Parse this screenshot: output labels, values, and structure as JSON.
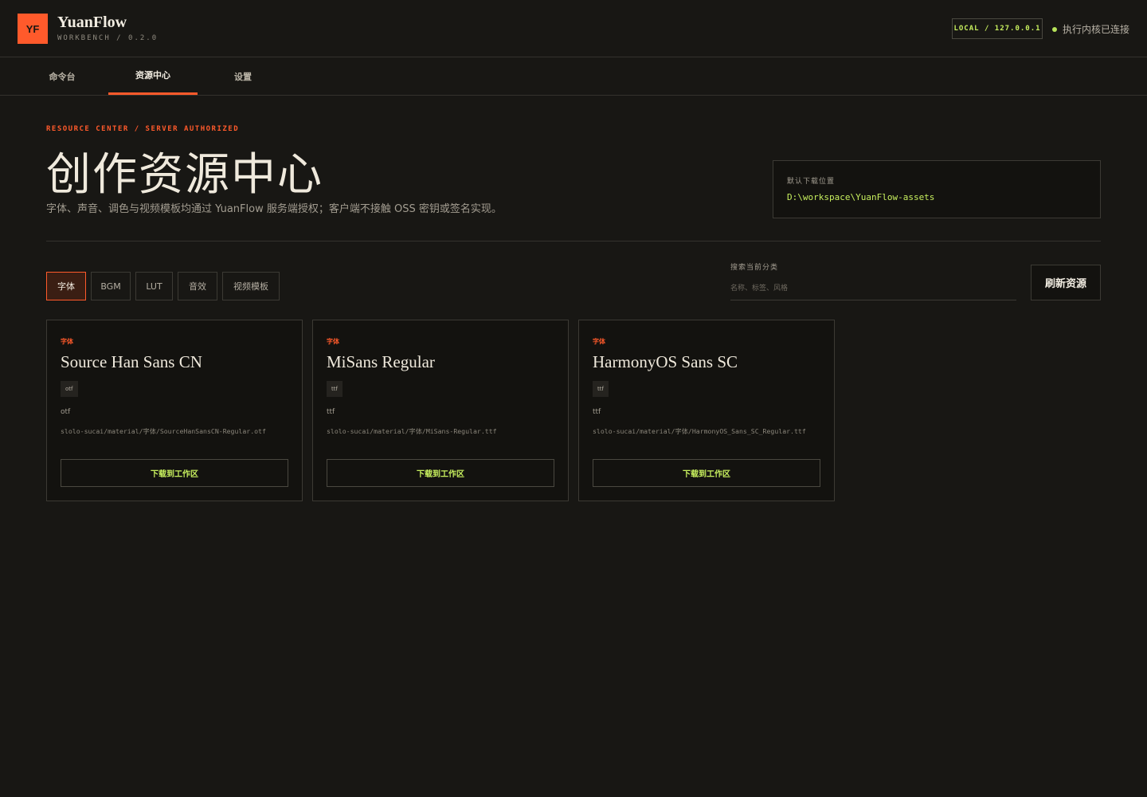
{
  "app": {
    "logo_text": "YF",
    "name": "YuanFlow",
    "version": "WORKBENCH / 0.2.0",
    "server_badge": "LOCAL / 127.0.0.1",
    "status_text": "执行内核已连接",
    "accent_color": "#ff5a2b",
    "ok_color": "#c7ef5e"
  },
  "nav": {
    "tabs": [
      {
        "label": "命令台",
        "active": false
      },
      {
        "label": "资源中心",
        "active": true
      },
      {
        "label": "设置",
        "active": false
      }
    ]
  },
  "hero": {
    "eyebrow": "RESOURCE CENTER / SERVER AUTHORIZED",
    "title": "创作资源中心",
    "subtitle": "字体、声音、调色与视频模板均通过 YuanFlow 服务端授权；客户端不接触 OSS 密钥或签名实现。",
    "download_label": "默认下载位置",
    "download_path": "D:\\workspace\\YuanFlow-assets"
  },
  "filters": {
    "categories": [
      {
        "label": "字体",
        "active": true
      },
      {
        "label": "BGM",
        "active": false
      },
      {
        "label": "LUT",
        "active": false
      },
      {
        "label": "音效",
        "active": false
      },
      {
        "label": "视频模板",
        "active": false
      }
    ],
    "search_label": "搜索当前分类",
    "search_placeholder": "名称、标签、风格",
    "search_value": "",
    "refresh_label": "刷新资源"
  },
  "resources": [
    {
      "category": "字体",
      "title": "Source Han Sans CN",
      "tag": "otf",
      "format": "otf",
      "path": "slolo-sucai/material/字体/SourceHanSansCN-Regular.otf",
      "button": "下载到工作区"
    },
    {
      "category": "字体",
      "title": "MiSans Regular",
      "tag": "ttf",
      "format": "ttf",
      "path": "slolo-sucai/material/字体/MiSans-Regular.ttf",
      "button": "下载到工作区"
    },
    {
      "category": "字体",
      "title": "HarmonyOS Sans SC",
      "tag": "ttf",
      "format": "ttf",
      "path": "slolo-sucai/material/字体/HarmonyOS_Sans_SC_Regular.ttf",
      "button": "下载到工作区"
    }
  ]
}
